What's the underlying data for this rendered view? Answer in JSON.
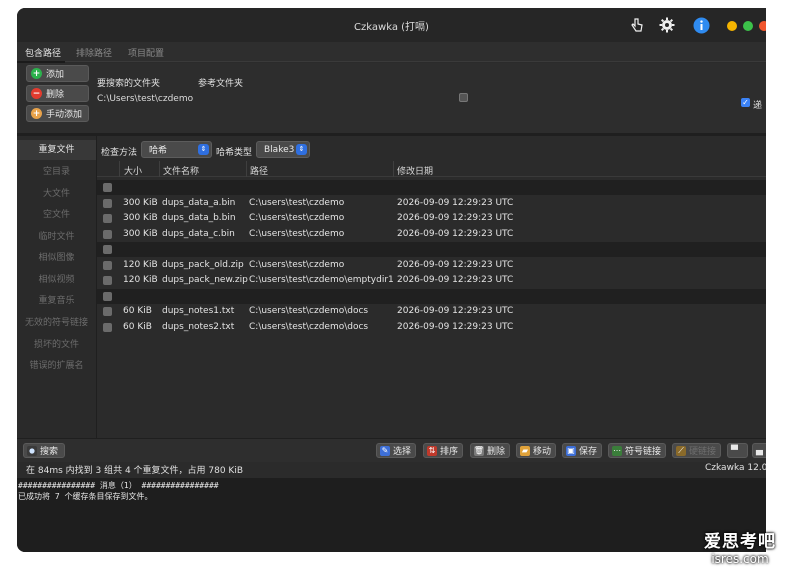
{
  "window": {
    "title": "Czkawka (打嗝)"
  },
  "titlebar_icons": [
    "hand-pointer-icon",
    "gear-icon",
    "info-icon"
  ],
  "traffic_colors": {
    "yellow": "#f5b400",
    "green": "#3cc24a",
    "red": "#f0562e"
  },
  "top_tabs": [
    {
      "label": "包含路径",
      "active": true
    },
    {
      "label": "排除路径",
      "active": false
    },
    {
      "label": "项目配置",
      "active": false
    }
  ],
  "dir_buttons": {
    "add": "添加",
    "remove": "删除",
    "manual_add": "手动添加"
  },
  "dir_table": {
    "col_search": "要搜索的文件夹",
    "col_reference": "参考文件夹",
    "path": "C:\\Users\\test\\czdemo",
    "recursive_label": "递"
  },
  "left_nav": [
    {
      "label": "重复文件",
      "active": true
    },
    {
      "label": "空目录",
      "active": false
    },
    {
      "label": "大文件",
      "active": false
    },
    {
      "label": "空文件",
      "active": false
    },
    {
      "label": "临时文件",
      "active": false
    },
    {
      "label": "相似图像",
      "active": false
    },
    {
      "label": "相似视频",
      "active": false
    },
    {
      "label": "重复音乐",
      "active": false
    },
    {
      "label": "无效的符号链接",
      "active": false
    },
    {
      "label": "损坏的文件",
      "active": false
    },
    {
      "label": "错误的扩展名",
      "active": false
    }
  ],
  "method_bar": {
    "check_method_label": "检查方法",
    "check_method_value": "哈希",
    "hash_type_label": "哈希类型",
    "hash_type_value": "Blake3"
  },
  "table": {
    "headers": {
      "size": "大小",
      "name": "文件名称",
      "path": "路径",
      "date": "修改日期"
    },
    "rows": [
      {
        "group": true
      },
      {
        "size": "300 KiB",
        "name": "dups_data_a.bin",
        "path": "C:\\users\\test\\czdemo",
        "date": "2026-09-09 12:29:23 UTC"
      },
      {
        "size": "300 KiB",
        "name": "dups_data_b.bin",
        "path": "C:\\users\\test\\czdemo",
        "date": "2026-09-09 12:29:23 UTC"
      },
      {
        "size": "300 KiB",
        "name": "dups_data_c.bin",
        "path": "C:\\users\\test\\czdemo",
        "date": "2026-09-09 12:29:23 UTC"
      },
      {
        "group": true
      },
      {
        "size": "120 KiB",
        "name": "dups_pack_old.zip",
        "path": "C:\\users\\test\\czdemo",
        "date": "2026-09-09 12:29:23 UTC"
      },
      {
        "size": "120 KiB",
        "name": "dups_pack_new.zip",
        "path": "C:\\users\\test\\czdemo\\emptydir1",
        "date": "2026-09-09 12:29:23 UTC"
      },
      {
        "group": true
      },
      {
        "size": "60 KiB",
        "name": "dups_notes1.txt",
        "path": "C:\\users\\test\\czdemo\\docs",
        "date": "2026-09-09 12:29:23 UTC"
      },
      {
        "size": "60 KiB",
        "name": "dups_notes2.txt",
        "path": "C:\\users\\test\\czdemo\\docs",
        "date": "2026-09-09 12:29:23 UTC"
      }
    ]
  },
  "bottom_buttons": {
    "search": "搜索",
    "select": "选择",
    "sort": "排序",
    "delete": "删除",
    "move": "移动",
    "save": "保存",
    "symlink": "符号链接",
    "hardlink": "硬链接"
  },
  "status": {
    "left": "在 84ms 内找到 3 组共 4 个重复文件，占用 780 KiB",
    "right": "Czkawka 12.0"
  },
  "log": {
    "line1": "################ 消息（1） ################",
    "line2": "已成功将 7 个缓存条目保存到文件。"
  },
  "watermark": {
    "line1": "爱思考吧",
    "line2": "isres.com"
  }
}
